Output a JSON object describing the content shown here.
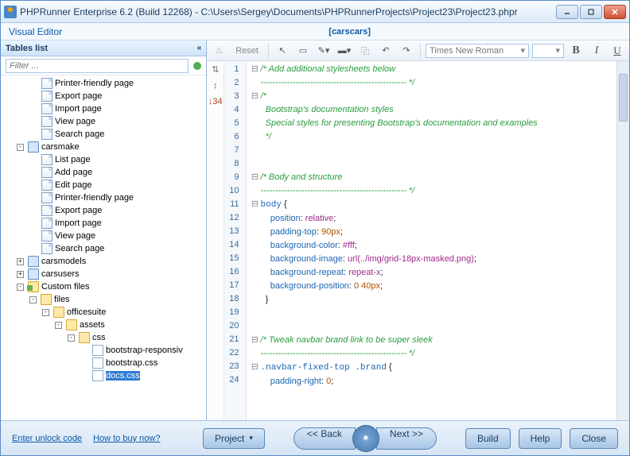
{
  "window": {
    "title": "PHPRunner Enterprise 6.2 (Build 12268) - C:\\Users\\Sergey\\Documents\\PHPRunnerProjects\\Project23\\Project23.phpr"
  },
  "header": {
    "visual_editor": "Visual Editor",
    "context": "[carscars]"
  },
  "sidebar": {
    "title": "Tables list",
    "filter_placeholder": "Filter ...",
    "tree": [
      {
        "d": 2,
        "ic": "page",
        "label": "Printer-friendly page"
      },
      {
        "d": 2,
        "ic": "page",
        "label": "Export page"
      },
      {
        "d": 2,
        "ic": "page",
        "label": "Import page"
      },
      {
        "d": 2,
        "ic": "page",
        "label": "View page"
      },
      {
        "d": 2,
        "ic": "page",
        "label": "Search page"
      },
      {
        "d": 1,
        "tog": "-",
        "ic": "db",
        "label": "carsmake"
      },
      {
        "d": 2,
        "ic": "page",
        "label": "List page"
      },
      {
        "d": 2,
        "ic": "page",
        "label": "Add page"
      },
      {
        "d": 2,
        "ic": "page",
        "label": "Edit page"
      },
      {
        "d": 2,
        "ic": "page",
        "label": "Printer-friendly page"
      },
      {
        "d": 2,
        "ic": "page",
        "label": "Export page"
      },
      {
        "d": 2,
        "ic": "page",
        "label": "Import page"
      },
      {
        "d": 2,
        "ic": "page",
        "label": "View page"
      },
      {
        "d": 2,
        "ic": "page",
        "label": "Search page"
      },
      {
        "d": 1,
        "tog": "+",
        "ic": "db",
        "label": "carsmodels"
      },
      {
        "d": 1,
        "tog": "+",
        "ic": "db",
        "label": "carsusers"
      },
      {
        "d": 1,
        "tog": "-",
        "ic": "folderx",
        "label": "Custom files"
      },
      {
        "d": 2,
        "tog": "-",
        "ic": "folder",
        "label": "files"
      },
      {
        "d": 3,
        "tog": "-",
        "ic": "folder",
        "label": "officesuite"
      },
      {
        "d": 4,
        "tog": "-",
        "ic": "folder",
        "label": "assets"
      },
      {
        "d": 5,
        "tog": "-",
        "ic": "folder",
        "label": "css"
      },
      {
        "d": 6,
        "ic": "file",
        "label": "bootstrap-responsiv"
      },
      {
        "d": 6,
        "ic": "file",
        "label": "bootstrap.css"
      },
      {
        "d": 6,
        "ic": "file",
        "label": "docs.css",
        "sel": true
      }
    ]
  },
  "toolbar": {
    "reset": "Reset",
    "font": "Times New Roman"
  },
  "code": {
    "lines": [
      {
        "n": 1,
        "f": "-",
        "seg": [
          {
            "c": "cm",
            "t": "/* Add additional stylesheets below"
          }
        ]
      },
      {
        "n": 2,
        "seg": [
          {
            "c": "cm",
            "t": "-------------------------------------------------- */"
          }
        ]
      },
      {
        "n": 3,
        "f": "-",
        "seg": [
          {
            "c": "cm",
            "t": "/*"
          }
        ]
      },
      {
        "n": 4,
        "seg": [
          {
            "c": "cm",
            "t": "  Bootstrap's documentation styles"
          }
        ]
      },
      {
        "n": 5,
        "seg": [
          {
            "c": "cm",
            "t": "  Special styles for presenting Bootstrap's documentation and examples"
          }
        ]
      },
      {
        "n": 6,
        "seg": [
          {
            "c": "cm",
            "t": "  */"
          }
        ]
      },
      {
        "n": 7,
        "seg": []
      },
      {
        "n": 8,
        "seg": []
      },
      {
        "n": 9,
        "f": "-",
        "seg": [
          {
            "c": "cm",
            "t": "/* Body and structure"
          }
        ]
      },
      {
        "n": 10,
        "seg": [
          {
            "c": "cm",
            "t": "-------------------------------------------------- */"
          }
        ]
      },
      {
        "n": 11,
        "f": "-",
        "seg": [
          {
            "c": "kw",
            "t": "body"
          },
          {
            "t": " {"
          }
        ]
      },
      {
        "n": 12,
        "seg": [
          {
            "t": "    "
          },
          {
            "c": "prop",
            "t": "position"
          },
          {
            "t": ": "
          },
          {
            "c": "val",
            "t": "relative"
          },
          {
            "t": ";"
          }
        ]
      },
      {
        "n": 13,
        "seg": [
          {
            "t": "    "
          },
          {
            "c": "prop",
            "t": "padding-top"
          },
          {
            "t": ": "
          },
          {
            "c": "num",
            "t": "90px"
          },
          {
            "t": ";"
          }
        ]
      },
      {
        "n": 14,
        "seg": [
          {
            "t": "    "
          },
          {
            "c": "prop",
            "t": "background-color"
          },
          {
            "t": ": "
          },
          {
            "c": "val",
            "t": "#fff"
          },
          {
            "t": ";"
          }
        ]
      },
      {
        "n": 15,
        "seg": [
          {
            "t": "    "
          },
          {
            "c": "prop",
            "t": "background-image"
          },
          {
            "t": ": "
          },
          {
            "c": "val",
            "t": "url(../img/grid-18px-masked.png)"
          },
          {
            "t": ";"
          }
        ]
      },
      {
        "n": 16,
        "seg": [
          {
            "t": "    "
          },
          {
            "c": "prop",
            "t": "background-repeat"
          },
          {
            "t": ": "
          },
          {
            "c": "val",
            "t": "repeat-x"
          },
          {
            "t": ";"
          }
        ]
      },
      {
        "n": 17,
        "seg": [
          {
            "t": "    "
          },
          {
            "c": "prop",
            "t": "background-position"
          },
          {
            "t": ": "
          },
          {
            "c": "num",
            "t": "0 40px"
          },
          {
            "t": ";"
          }
        ]
      },
      {
        "n": 18,
        "seg": [
          {
            "t": "  }"
          }
        ]
      },
      {
        "n": 19,
        "seg": []
      },
      {
        "n": 20,
        "seg": []
      },
      {
        "n": 21,
        "f": "-",
        "seg": [
          {
            "c": "cm",
            "t": "/* Tweak navbar brand link to be super sleek"
          }
        ]
      },
      {
        "n": 22,
        "seg": [
          {
            "c": "cm",
            "t": "-------------------------------------------------- */"
          }
        ]
      },
      {
        "n": 23,
        "f": "-",
        "seg": [
          {
            "c": "kw",
            "t": ".navbar-fixed-top .brand"
          },
          {
            "t": " {"
          }
        ]
      },
      {
        "n": 24,
        "seg": [
          {
            "t": "    "
          },
          {
            "c": "prop",
            "t": "padding-right"
          },
          {
            "t": ": "
          },
          {
            "c": "num",
            "t": "0"
          },
          {
            "t": ";"
          }
        ]
      }
    ]
  },
  "gutter": {
    "arrows": "↕",
    "num": "↓34"
  },
  "footer": {
    "unlock": "Enter unlock code",
    "buy": "How to buy now?",
    "project": "Project",
    "back": "<<  Back",
    "next": "Next  >>",
    "build": "Build",
    "help": "Help",
    "close": "Close"
  }
}
